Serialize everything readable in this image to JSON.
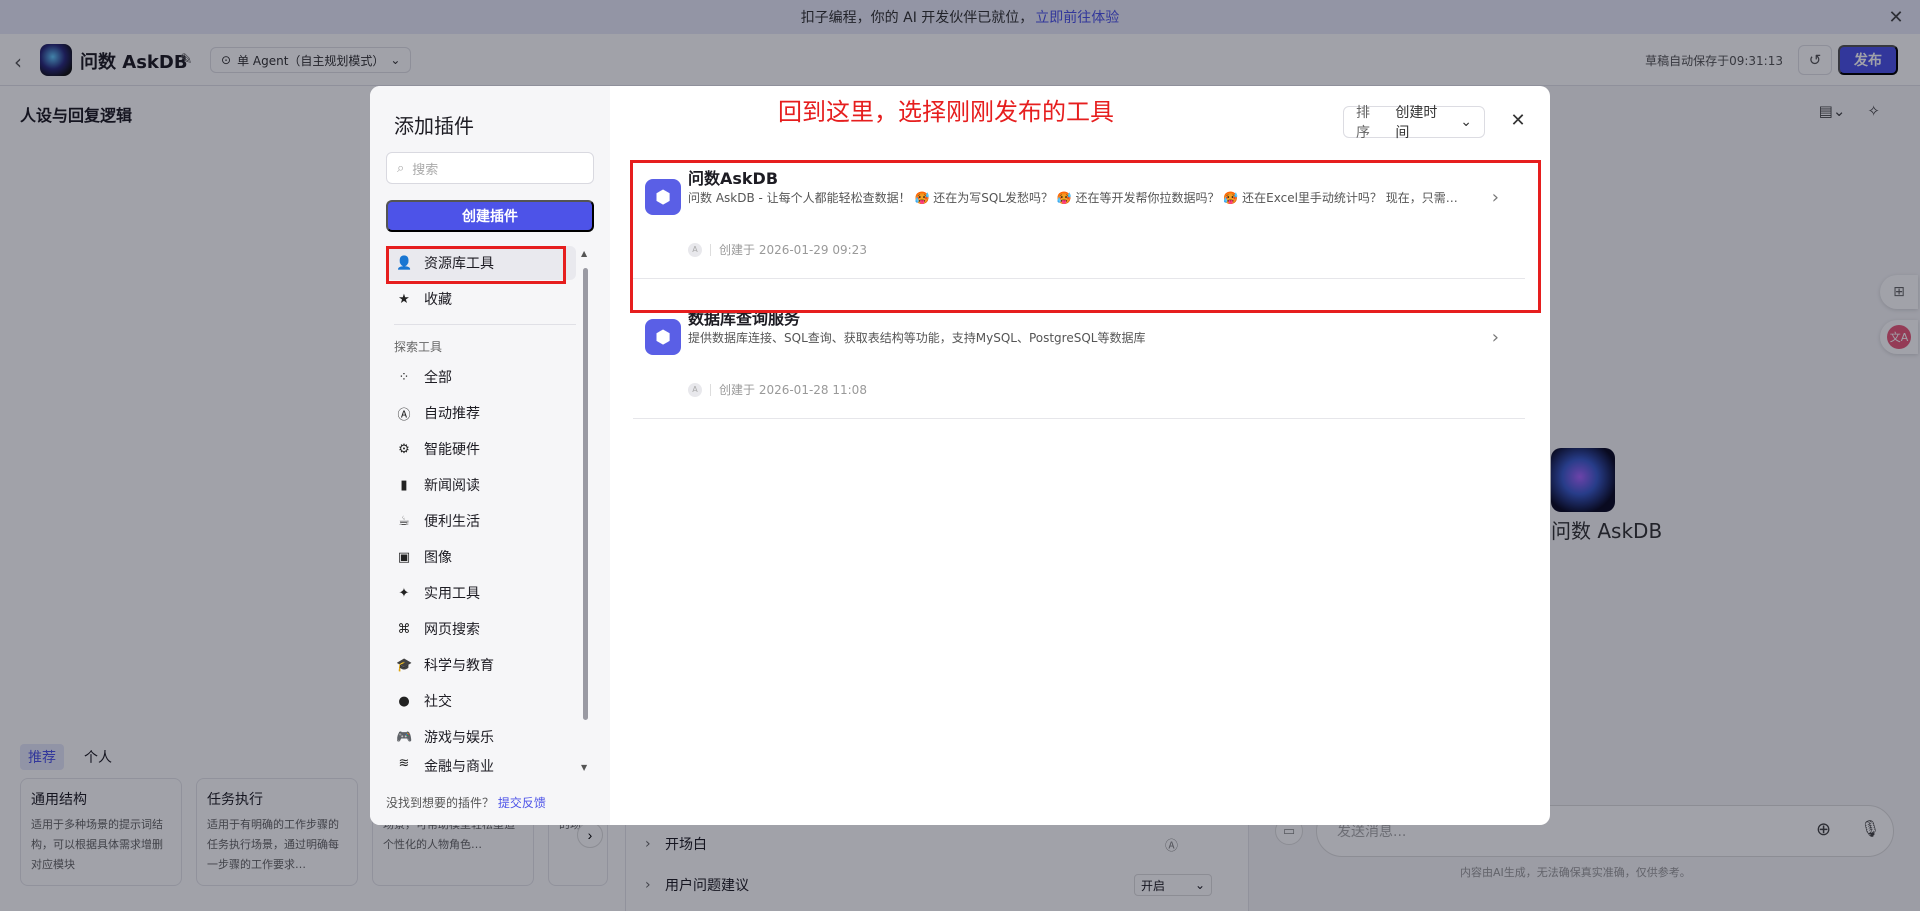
{
  "banner": {
    "text": "扣子编程，你的 AI 开发伙伴已就位，",
    "link": "立即前往体验"
  },
  "header": {
    "bot_name": "问数 AskDB",
    "agent_mode": "单 Agent（自主规划模式）",
    "autosave": "草稿自动保存于09:31:13",
    "publish": "发布"
  },
  "persona": {
    "title": "人设与回复逻辑"
  },
  "templates": {
    "tabs": [
      "推荐",
      "个人"
    ],
    "cards": [
      {
        "title": "通用结构",
        "desc": "适用于多种场景的提示词结构，可以根据具体需求增删对应模块"
      },
      {
        "title": "任务执行",
        "desc": "适用于有明确的工作步骤的任务执行场景，通过明确每一步骤的工作要求…"
      },
      {
        "title": "",
        "desc": "适用于角色扮演、互动娱乐场景，可帮助模型轻松塑造个性化的人物角色…"
      },
      {
        "title": "",
        "desc": "获取…的场景"
      }
    ]
  },
  "mid": {
    "opening": "开场白",
    "suggest": "用户问题建议",
    "suggest_value": "开启"
  },
  "chat": {
    "bot_name": "问数 AskDB",
    "placeholder": "发送消息...",
    "disclaimer": "内容由AI生成，无法确保真实准确，仅供参考。"
  },
  "modal": {
    "title": "添加插件",
    "search_placeholder": "搜索",
    "create_button": "创建插件",
    "nav_top": [
      {
        "label": "资源库工具",
        "icon": "person-icon"
      },
      {
        "label": "收藏",
        "icon": "star-icon"
      }
    ],
    "explore_label": "探索工具",
    "nav_explore": [
      {
        "label": "全部",
        "icon": "grid-icon"
      },
      {
        "label": "自动推荐",
        "icon": "ai-icon"
      },
      {
        "label": "智能硬件",
        "icon": "chip-icon"
      },
      {
        "label": "新闻阅读",
        "icon": "book-icon"
      },
      {
        "label": "便利生活",
        "icon": "cup-icon"
      },
      {
        "label": "图像",
        "icon": "image-icon"
      },
      {
        "label": "实用工具",
        "icon": "wrench-icon"
      },
      {
        "label": "网页搜索",
        "icon": "network-icon"
      },
      {
        "label": "科学与教育",
        "icon": "graduation-icon"
      },
      {
        "label": "社交",
        "icon": "chat-icon"
      },
      {
        "label": "游戏与娱乐",
        "icon": "gamepad-icon"
      },
      {
        "label": "金融与商业",
        "icon": "coins-icon"
      }
    ],
    "feedback_text": "没找到想要的插件？",
    "feedback_link": "提交反馈",
    "annotation": "回到这里，选择刚刚发布的工具",
    "sort_label": "排序",
    "sort_value": "创建时间",
    "plugins": [
      {
        "name": "问数AskDB",
        "desc": "问数 AskDB - 让每个人都能轻松查数据！ 🥵 还在为写SQL发愁吗？ 🥵 还在等开发帮你拉数据吗？ 🥵 还在Excel里手动统计吗？ 现在，只需…",
        "created": "创建于 2026-01-29 09:23"
      },
      {
        "name": "数据库查询服务",
        "desc": "提供数据库连接、SQL查询、获取表结构等功能，支持MySQL、PostgreSQL等数据库",
        "created": "创建于 2026-01-28 11:08"
      }
    ]
  },
  "colors": {
    "accent": "#4d53e8",
    "annotation": "#e61e1e"
  }
}
